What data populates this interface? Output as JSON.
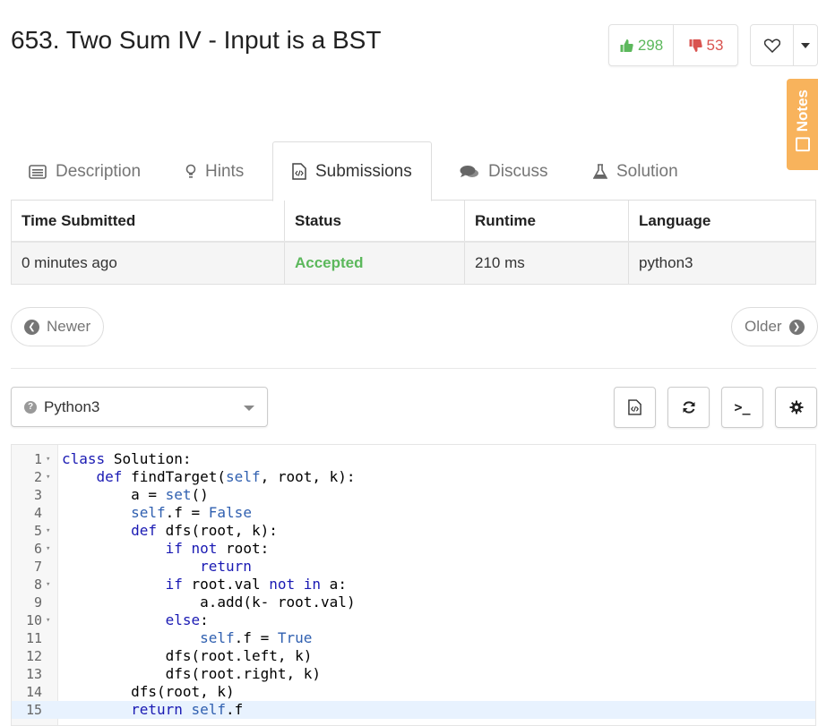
{
  "problem": {
    "title": "653. Two Sum IV - Input is a BST"
  },
  "votes": {
    "up": "298",
    "down": "53"
  },
  "notes_label": "Notes",
  "tabs": [
    {
      "label": "Description",
      "icon": "list-icon"
    },
    {
      "label": "Hints",
      "icon": "lightbulb-icon"
    },
    {
      "label": "Submissions",
      "icon": "code-file-icon"
    },
    {
      "label": "Discuss",
      "icon": "comments-icon"
    },
    {
      "label": "Solution",
      "icon": "flask-icon"
    }
  ],
  "table": {
    "headers": [
      "Time Submitted",
      "Status",
      "Runtime",
      "Language"
    ],
    "row": {
      "time": "0 minutes ago",
      "status": "Accepted",
      "runtime": "210 ms",
      "language": "python3"
    }
  },
  "nav": {
    "newer": "Newer",
    "older": "Older"
  },
  "language_select": {
    "value": "Python3"
  },
  "toolbar": {
    "console_label": ">_"
  },
  "colors": {
    "accepted": "#5cb85c",
    "downvote": "#d9534f",
    "notes": "#f8b35c"
  },
  "code": {
    "lines": [
      {
        "n": "1",
        "text": "class Solution:",
        "fold": true
      },
      {
        "n": "2",
        "text": "    def findTarget(self, root, k):",
        "fold": true
      },
      {
        "n": "3",
        "text": "        a = set()",
        "fold": false
      },
      {
        "n": "4",
        "text": "        self.f = False",
        "fold": false
      },
      {
        "n": "5",
        "text": "        def dfs(root, k):",
        "fold": true
      },
      {
        "n": "6",
        "text": "            if not root:",
        "fold": true
      },
      {
        "n": "7",
        "text": "                return",
        "fold": false
      },
      {
        "n": "8",
        "text": "            if root.val not in a:",
        "fold": true
      },
      {
        "n": "9",
        "text": "                a.add(k- root.val)",
        "fold": false
      },
      {
        "n": "10",
        "text": "            else:",
        "fold": true
      },
      {
        "n": "11",
        "text": "                self.f = True",
        "fold": false
      },
      {
        "n": "12",
        "text": "            dfs(root.left, k)",
        "fold": false
      },
      {
        "n": "13",
        "text": "            dfs(root.right, k)",
        "fold": false
      },
      {
        "n": "14",
        "text": "        dfs(root, k)",
        "fold": false
      },
      {
        "n": "15",
        "text": "        return self.f",
        "fold": false
      }
    ],
    "highlighted_line": "15"
  }
}
